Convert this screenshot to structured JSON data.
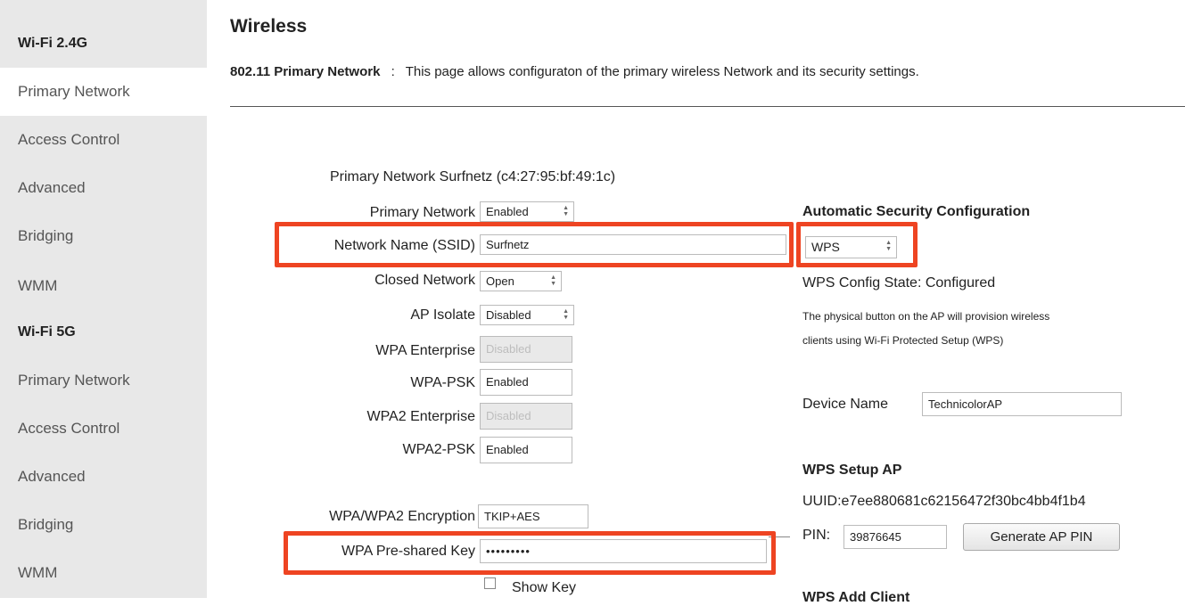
{
  "sidebar": {
    "items": [
      {
        "label": "Wi-Fi 2.4G",
        "type": "group"
      },
      {
        "label": "Primary Network",
        "type": "item",
        "active": true
      },
      {
        "label": "Access Control",
        "type": "item"
      },
      {
        "label": "Advanced",
        "type": "item"
      },
      {
        "label": "Bridging",
        "type": "item"
      },
      {
        "label": "WMM",
        "type": "item"
      },
      {
        "label": "Wi-Fi 5G",
        "type": "group"
      },
      {
        "label": "Primary Network",
        "type": "item"
      },
      {
        "label": "Access Control",
        "type": "item"
      },
      {
        "label": "Advanced",
        "type": "item"
      },
      {
        "label": "Bridging",
        "type": "item"
      },
      {
        "label": "WMM",
        "type": "item"
      }
    ]
  },
  "page": {
    "title": "Wireless",
    "desc_bold": "802.11 Primary Network",
    "desc_sep": ":",
    "desc_text": "This page allows configuraton of the primary wireless Network and its security settings."
  },
  "form": {
    "header": "Primary Network Surfnetz (c4:27:95:bf:49:1c)",
    "primary_network": {
      "label": "Primary Network",
      "value": "Enabled"
    },
    "ssid": {
      "label": "Network Name (SSID)",
      "value": "Surfnetz"
    },
    "closed_network": {
      "label": "Closed Network",
      "value": "Open"
    },
    "ap_isolate": {
      "label": "AP Isolate",
      "value": "Disabled"
    },
    "wpa_enterprise": {
      "label": "WPA Enterprise",
      "value": "Disabled"
    },
    "wpa_psk": {
      "label": "WPA-PSK",
      "value": "Enabled"
    },
    "wpa2_enterprise": {
      "label": "WPA2 Enterprise",
      "value": "Disabled"
    },
    "wpa2_psk": {
      "label": "WPA2-PSK",
      "value": "Enabled"
    },
    "encryption": {
      "label": "WPA/WPA2 Encryption",
      "value": "TKIP+AES"
    },
    "psk": {
      "label": "WPA Pre-shared Key",
      "value": "•••••••••"
    },
    "show_key": {
      "label": "Show Key"
    }
  },
  "security": {
    "heading": "Automatic Security Configuration",
    "mode": "WPS",
    "config_state": "WPS Config State: Configured",
    "note_line1": "The physical button on the AP will provision wireless",
    "note_line2": "clients using Wi-Fi Protected Setup (WPS)",
    "device_name_label": "Device Name",
    "device_name_value": "TechnicolorAP",
    "setup_heading": "WPS Setup AP",
    "uuid": "UUID:e7ee880681c62156472f30bc4bb4f1b4",
    "pin_label": "PIN:",
    "pin_value": "39876645",
    "generate_button": "Generate AP PIN",
    "add_client_heading": "WPS Add Client"
  },
  "colors": {
    "highlight": "#ee4422",
    "sidebar_bg": "#e8e8e8"
  }
}
